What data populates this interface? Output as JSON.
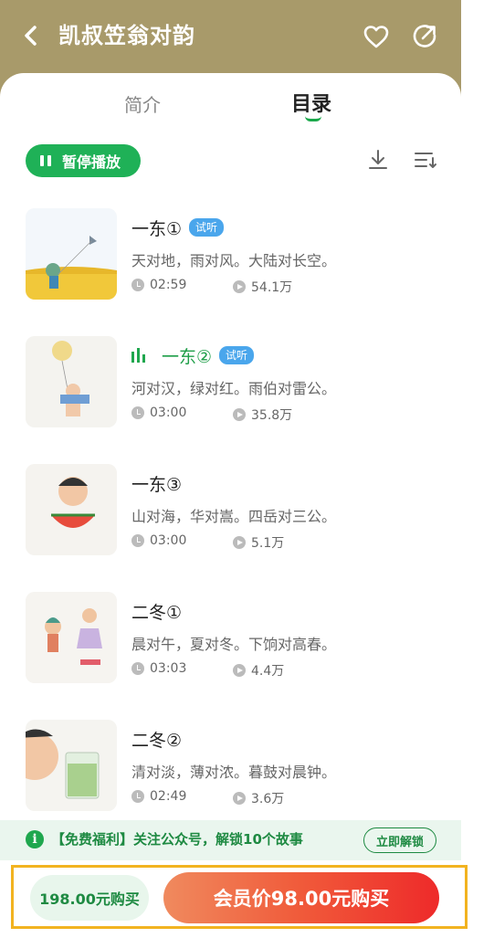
{
  "header": {
    "title": "凯叔笠翁对韵"
  },
  "tabs": [
    {
      "label": "简介"
    },
    {
      "label": "目录"
    }
  ],
  "toolbar": {
    "pause_label": "暂停播放"
  },
  "items": [
    {
      "title": "一东①",
      "badge": "试听",
      "desc": "天对地，雨对风。大陆对长空。",
      "duration": "02:59",
      "plays": "54.1万",
      "playing": false
    },
    {
      "title": "一东②",
      "badge": "试听",
      "desc": "河对汉，绿对红。雨伯对雷公。",
      "duration": "03:00",
      "plays": "35.8万",
      "playing": true
    },
    {
      "title": "一东③",
      "badge": "",
      "desc": "山对海，华对嵩。四岳对三公。",
      "duration": "03:00",
      "plays": "5.1万",
      "playing": false
    },
    {
      "title": "二冬①",
      "badge": "",
      "desc": "晨对午，夏对冬。下饷对高春。",
      "duration": "03:03",
      "plays": "4.4万",
      "playing": false
    },
    {
      "title": "二冬②",
      "badge": "",
      "desc": "清对淡，薄对浓。暮鼓对晨钟。",
      "duration": "02:49",
      "plays": "3.6万",
      "playing": false
    }
  ],
  "notice": {
    "text": "【免费福利】关注公众号，解锁10个故事",
    "button": "立即解锁"
  },
  "purchase": {
    "regular": "198.00元购买",
    "member": "会员价98.00元购买"
  },
  "colors": {
    "header": "#a89a6a",
    "accent": "#1fb157",
    "badge": "#4aa6ec",
    "highlight_border": "#f2b320"
  }
}
